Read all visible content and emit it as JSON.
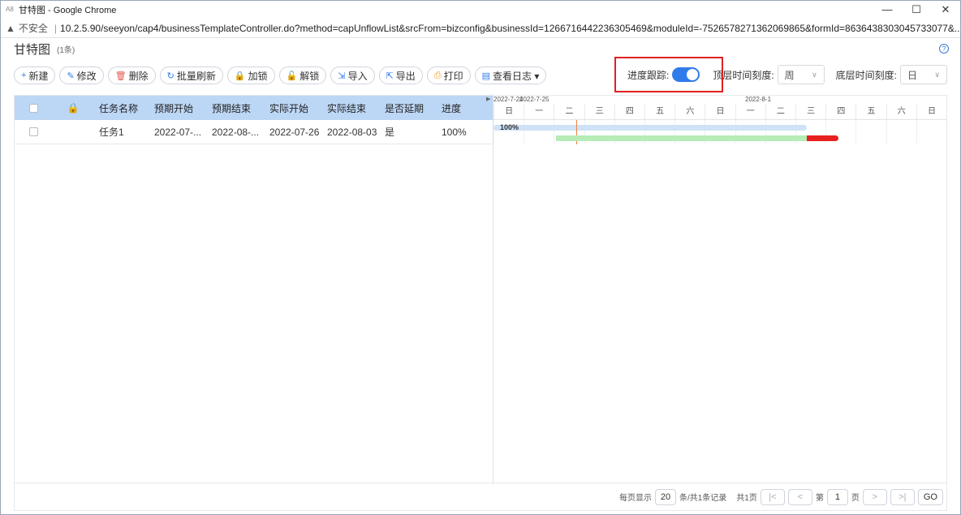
{
  "window": {
    "title": "甘特图 - Google Chrome",
    "minimize": "—",
    "maximize": "☐",
    "close": "✕"
  },
  "address": {
    "warning_icon": "▲",
    "insecure": "不安全",
    "separator": "|",
    "url": "10.2.5.90/seeyon/cap4/businessTemplateController.do?method=capUnflowList&srcFrom=bizconfig&businessId=1266716442236305469&moduleId=-7526578271362069865&formId=8636438303045733077&..."
  },
  "page": {
    "title": "甘特图",
    "count": "(1条)",
    "help_icon": "?"
  },
  "toolbar": [
    {
      "icon": "+",
      "label": "新建",
      "color": "#2f7bea"
    },
    {
      "icon": "✎",
      "label": "修改",
      "color": "#2f7bea"
    },
    {
      "icon": "🗑",
      "label": "删除",
      "color": "#e85a4f"
    },
    {
      "icon": "↻",
      "label": "批量刷新",
      "color": "#2f7bea"
    },
    {
      "icon": "🔒",
      "label": "加锁",
      "color": "#2f7bea"
    },
    {
      "icon": "🔓",
      "label": "解锁",
      "color": "#2f7bea"
    },
    {
      "icon": "⇲",
      "label": "导入",
      "color": "#2f7bea"
    },
    {
      "icon": "⇱",
      "label": "导出",
      "color": "#2f7bea"
    },
    {
      "icon": "⎙",
      "label": "打印",
      "color": "#f0a020"
    },
    {
      "icon": "▤",
      "label": "查看日志 ▾",
      "color": "#2f7bea"
    }
  ],
  "controls": {
    "track_label": "进度跟踪:",
    "track_on": true,
    "top_scale_label": "顶层时间刻度:",
    "top_scale_value": "周",
    "bottom_scale_label": "底层时间刻度:",
    "bottom_scale_value": "日",
    "chevron": "∨",
    "toggle_color": "#2f7bea",
    "highlight_color": "#e02020"
  },
  "table": {
    "headers": {
      "lock": "🔒",
      "name": "任务名称",
      "plan_start": "预期开始",
      "plan_end": "预期结束",
      "actual_start": "实际开始",
      "actual_end": "实际结束",
      "delayed": "是否延期",
      "progress": "进度"
    },
    "rows": [
      {
        "name": "任务1",
        "plan_start": "2022-07-...",
        "plan_end": "2022-08-...",
        "actual_start": "2022-07-26",
        "actual_end": "2022-08-03",
        "delayed": "是",
        "progress": "100%"
      }
    ]
  },
  "gantt": {
    "scroll_arrow": "▶",
    "weeks": [
      "2022-7-24",
      "2022-7-25",
      "2022-8-1"
    ],
    "days": [
      "日",
      "一",
      "二",
      "三",
      "四",
      "五",
      "六",
      "日",
      "一",
      "二",
      "三",
      "四",
      "五",
      "六",
      "日"
    ],
    "bar_label": "100%",
    "progress": 1.0,
    "colors": {
      "plan": "#cfe2f7",
      "actual": "#b6ecb6",
      "late": "#e82020",
      "today": "#f08040"
    }
  },
  "footer": {
    "per_page_label": "每页显示",
    "per_page": "20",
    "records": "条/共1条记录",
    "total_pages": "共1页",
    "first": "|<",
    "prev": "<",
    "page_prefix": "第",
    "page": "1",
    "page_suffix": "页",
    "next": ">",
    "last": ">|",
    "go": "GO"
  }
}
